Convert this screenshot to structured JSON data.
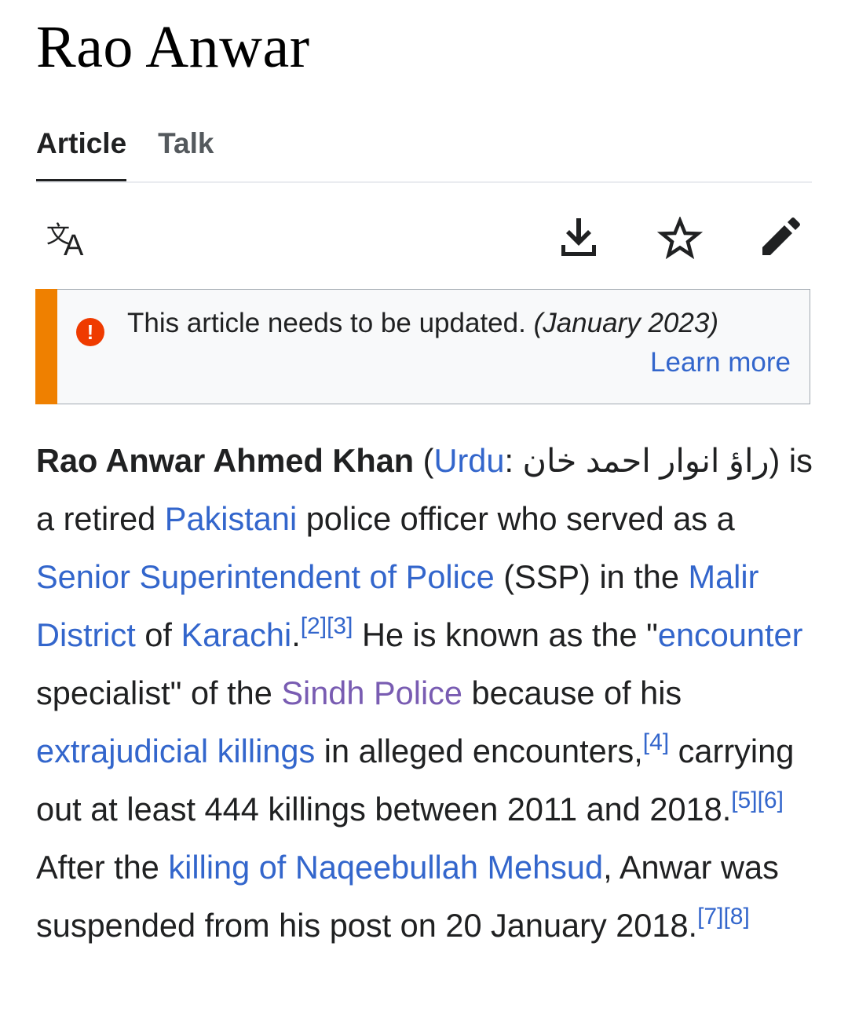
{
  "page": {
    "title": "Rao Anwar"
  },
  "tabs": [
    {
      "label": "Article",
      "active": true
    },
    {
      "label": "Talk",
      "active": false
    }
  ],
  "toolbar": {
    "language_icon": "translate-icon",
    "actions": [
      "download-icon",
      "star-watch-icon",
      "pencil-edit-icon"
    ]
  },
  "notice": {
    "icon": "exclamation-icon",
    "text": "This article needs to be updated.",
    "date": "(January 2023)",
    "link": "Learn more",
    "accent_color": "#ef8000"
  },
  "article": {
    "subject": "Rao Anwar Ahmed Khan",
    "open_paren": " (",
    "lang_link": "Urdu",
    "colon": ": ",
    "urdu_name": "راؤ انوار احمد خان",
    "t1": ") is a retired ",
    "link_pakistani": "Pakistani",
    "t2": " police officer who served as a ",
    "link_ssp": "Senior Superintendent of Police",
    "t3": " (SSP) in the ",
    "link_malir": "Malir District",
    "t4": " of ",
    "link_karachi": "Karachi",
    "t5": ".",
    "ref_2": "[2]",
    "ref_3": "[3]",
    "t6": " He is known as the \"",
    "link_encounter": "encounter",
    "t7": " specialist\" of the ",
    "link_sindh": "Sindh Police",
    "t8": " because of his ",
    "link_extrajudicial": "extrajudicial killings",
    "t9": " in alleged encounters,",
    "ref_4": "[4]",
    "t10": " carrying out at least 444 killings between 2011 and 2018.",
    "ref_5": "[5]",
    "ref_6": "[6]",
    "t11": " After the ",
    "link_killing": "killing of Naqeebullah Mehsud",
    "t12": ", Anwar was suspended from his post on 20 January 2018.",
    "ref_7": "[7]",
    "ref_8": "[8]"
  },
  "colors": {
    "link": "#3366cc",
    "visited_link": "#795cb2",
    "text": "#202122",
    "notice_icon": "#ef3b00"
  }
}
